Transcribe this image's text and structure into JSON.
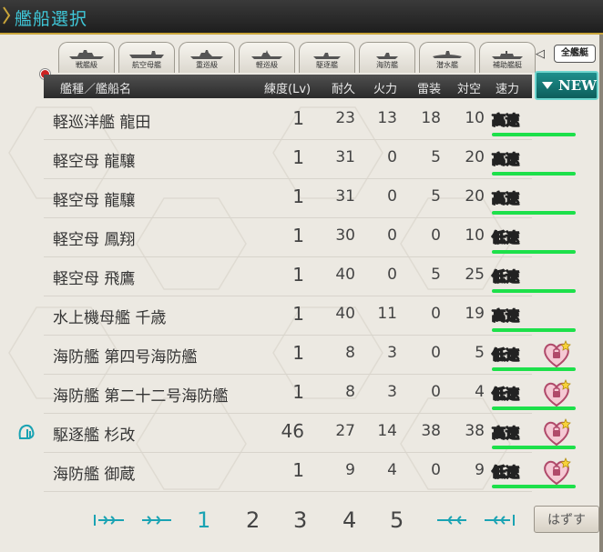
{
  "window": {
    "title": "艦船選択"
  },
  "tabs": [
    {
      "label": "戦艦級"
    },
    {
      "label": "航空母艦"
    },
    {
      "label": "重巡級"
    },
    {
      "label": "軽巡級"
    },
    {
      "label": "駆逐艦"
    },
    {
      "label": "海防艦"
    },
    {
      "label": "潜水艦"
    },
    {
      "label": "補助艦艇"
    }
  ],
  "all_button": {
    "label": "全艦艇"
  },
  "sort_button": {
    "label": "NEW"
  },
  "header": {
    "name": "艦種／艦船名",
    "level": "練度(Lv)",
    "hp": "耐久",
    "firepower": "火力",
    "torpedo": "雷装",
    "antiair": "対空",
    "speed": "速力"
  },
  "rows": [
    {
      "name": "軽巡洋艦 龍田",
      "level": "1",
      "hp": "23",
      "firepower": "13",
      "torpedo": "18",
      "antiair": "10",
      "speed": "高速",
      "locked": false,
      "marriage": false
    },
    {
      "name": "軽空母 龍驤",
      "level": "1",
      "hp": "31",
      "firepower": "0",
      "torpedo": "5",
      "antiair": "20",
      "speed": "高速",
      "locked": false,
      "marriage": false
    },
    {
      "name": "軽空母 龍驤",
      "level": "1",
      "hp": "31",
      "firepower": "0",
      "torpedo": "5",
      "antiair": "20",
      "speed": "高速",
      "locked": false,
      "marriage": false
    },
    {
      "name": "軽空母 鳳翔",
      "level": "1",
      "hp": "30",
      "firepower": "0",
      "torpedo": "0",
      "antiair": "10",
      "speed": "低速",
      "locked": false,
      "marriage": false
    },
    {
      "name": "軽空母 飛鷹",
      "level": "1",
      "hp": "40",
      "firepower": "0",
      "torpedo": "5",
      "antiair": "25",
      "speed": "低速",
      "locked": false,
      "marriage": false
    },
    {
      "name": "水上機母艦 千歳",
      "level": "1",
      "hp": "40",
      "firepower": "11",
      "torpedo": "0",
      "antiair": "19",
      "speed": "高速",
      "locked": false,
      "marriage": false
    },
    {
      "name": "海防艦 第四号海防艦",
      "level": "1",
      "hp": "8",
      "firepower": "3",
      "torpedo": "0",
      "antiair": "5",
      "speed": "低速",
      "locked": true,
      "marriage": false
    },
    {
      "name": "海防艦 第二十二号海防艦",
      "level": "1",
      "hp": "8",
      "firepower": "3",
      "torpedo": "0",
      "antiair": "4",
      "speed": "低速",
      "locked": true,
      "marriage": false
    },
    {
      "name": "駆逐艦 杉改",
      "level": "46",
      "hp": "27",
      "firepower": "14",
      "torpedo": "38",
      "antiair": "38",
      "speed": "高速",
      "locked": true,
      "marriage": true
    },
    {
      "name": "海防艦 御蔵",
      "level": "1",
      "hp": "9",
      "firepower": "4",
      "torpedo": "0",
      "antiair": "9",
      "speed": "低速",
      "locked": true,
      "marriage": false
    }
  ],
  "pagination": {
    "pages": [
      "1",
      "2",
      "3",
      "4",
      "5"
    ],
    "current": "1"
  },
  "remove_button": {
    "label": "はずす"
  },
  "colors": {
    "accent": "#1aa3b3",
    "speed_bar": "#1de04a",
    "title": "#3fc7d8"
  },
  "icons": {
    "lock": "heart-lock-icon",
    "badge": "fleet-badge-icon"
  }
}
